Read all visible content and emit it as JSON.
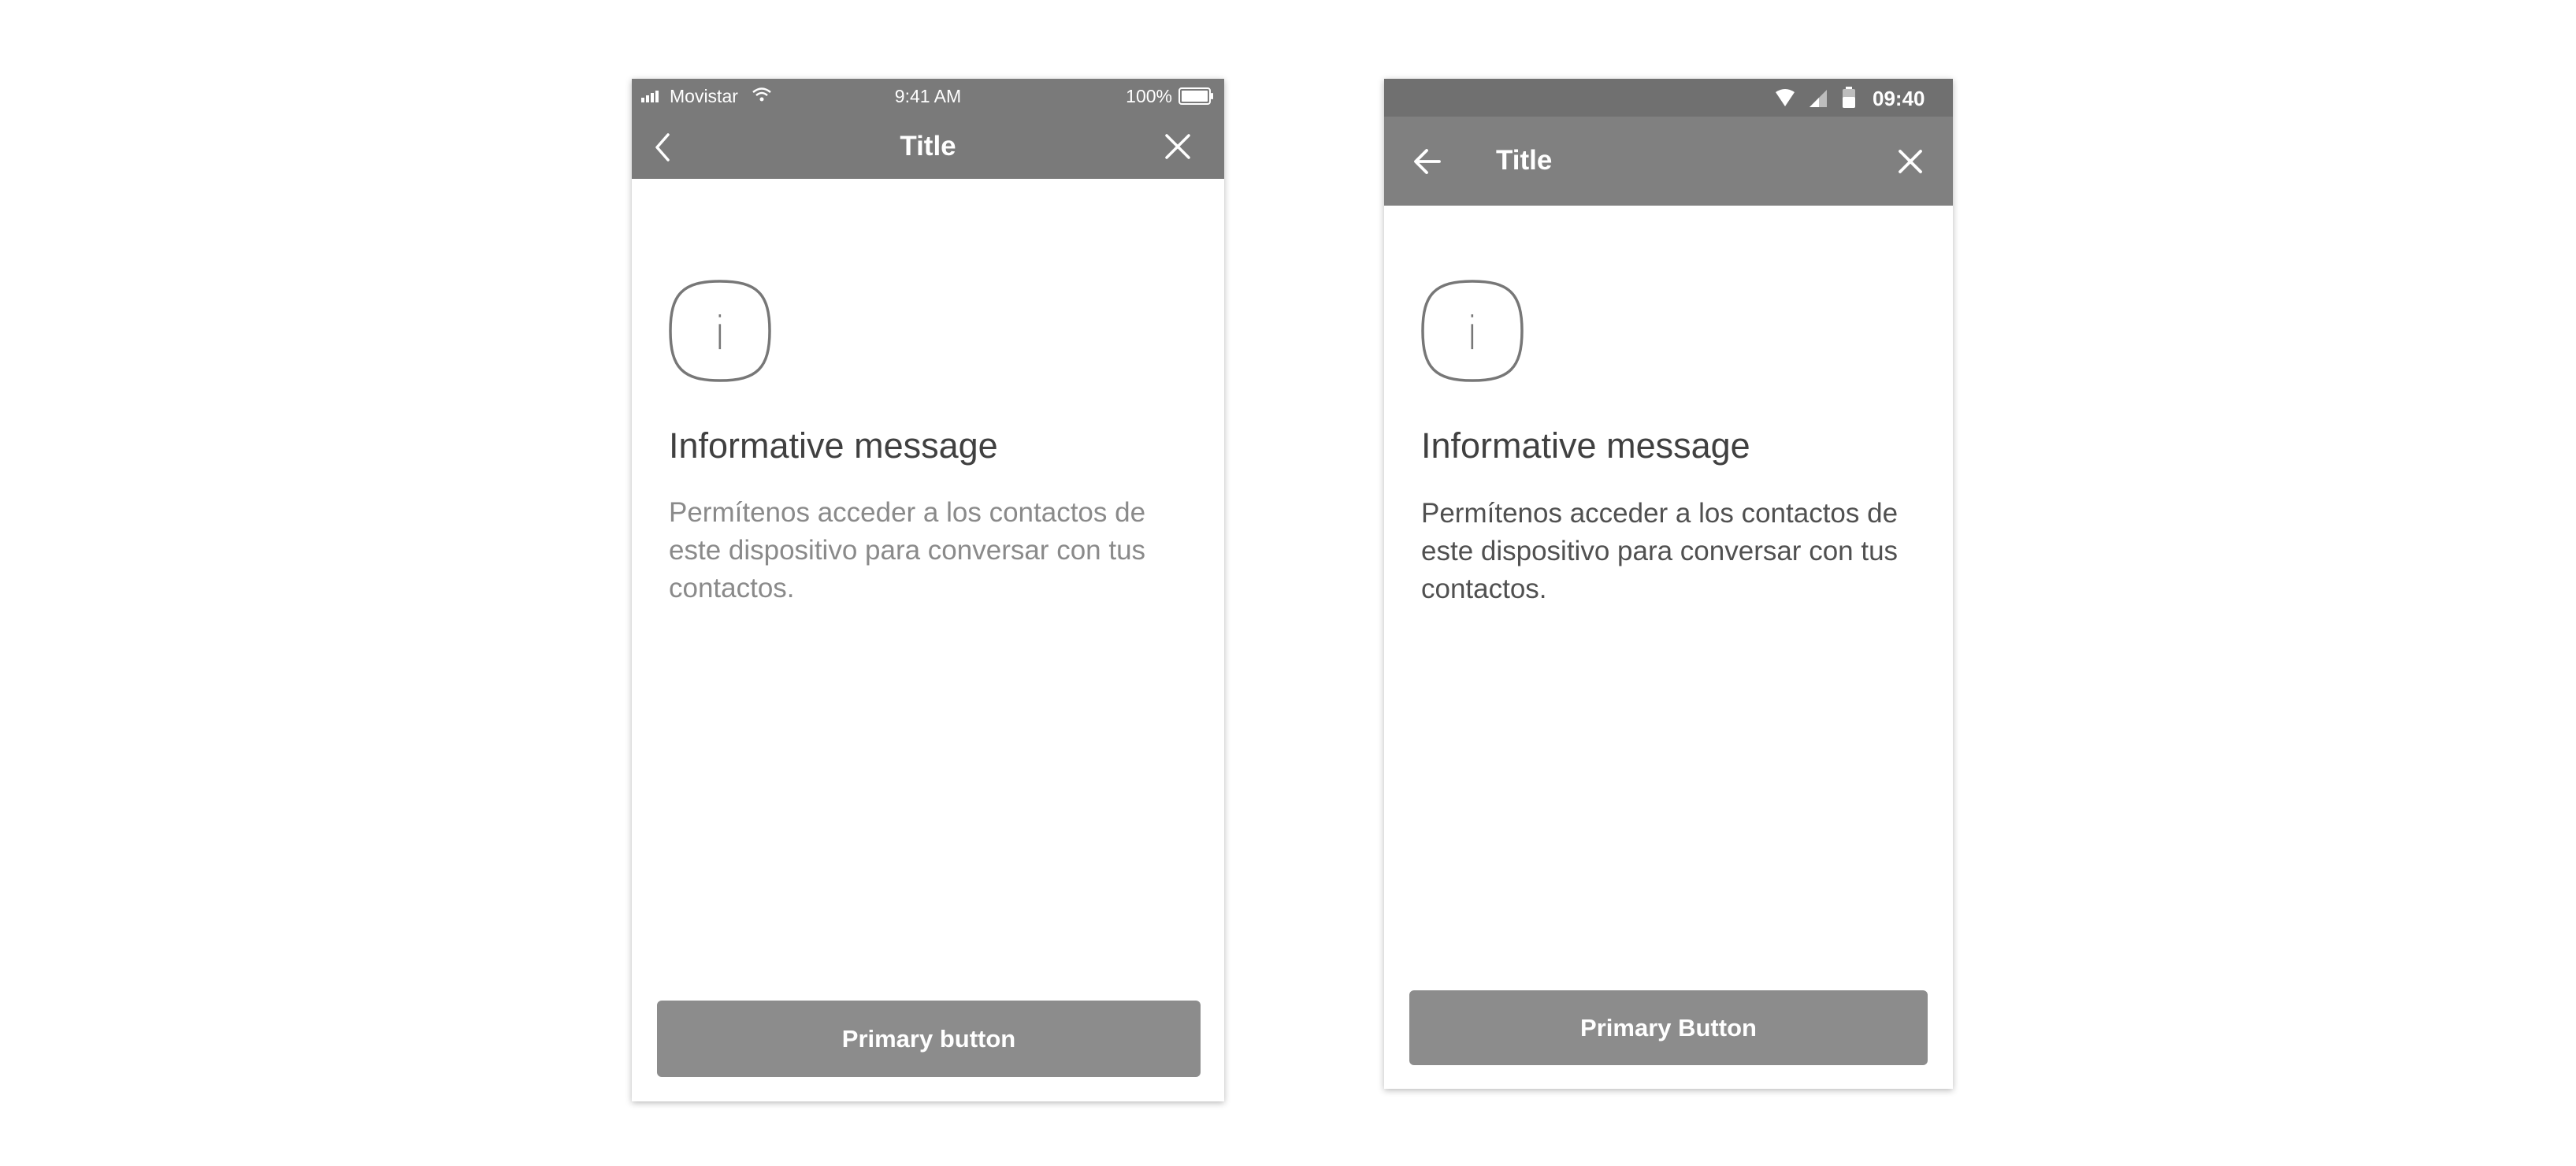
{
  "ios": {
    "status": {
      "carrier": "Movistar",
      "time": "9:41 AM",
      "battery": "100%"
    },
    "nav": {
      "title": "Title",
      "back_icon": "chevron-left-icon",
      "close_icon": "close-icon"
    },
    "content": {
      "icon": "info-icon",
      "icon_glyph": "i",
      "heading": "Informative message",
      "body_lines": [
        "Permítenos acceder a los contactos de",
        "este dispositivo para conversar con tus",
        "contactos."
      ]
    },
    "button": {
      "label": "Primary button"
    }
  },
  "android": {
    "status": {
      "time": "09:40"
    },
    "nav": {
      "title": "Title",
      "back_icon": "arrow-left-icon",
      "close_icon": "close-icon"
    },
    "content": {
      "icon": "info-icon",
      "icon_glyph": "i",
      "heading": "Informative message",
      "body_lines": [
        "Permítenos acceder a los contactos de",
        "este dispositivo para conversar con tus",
        "contactos."
      ]
    },
    "button": {
      "label": "Primary Button"
    }
  },
  "colors": {
    "bar": "#7a7a7a",
    "button": "#8c8c8c",
    "heading": "#404040"
  }
}
